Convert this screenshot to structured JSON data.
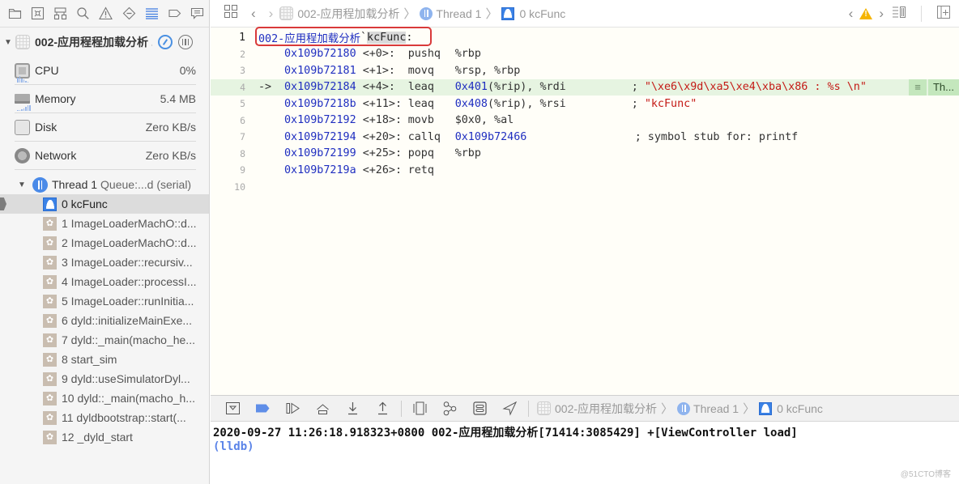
{
  "sidebar": {
    "nav_icons": [
      "folder-icon",
      "source-control-icon",
      "hierarchy-icon",
      "search-icon",
      "warning-icon",
      "breakpoint-icon",
      "debug-navigator-icon",
      "tag-icon",
      "report-icon"
    ],
    "process": {
      "name": "002-应用程程加载分析 ...",
      "icon": "app-icon"
    },
    "gauges": [
      {
        "label": "CPU",
        "value": "0%",
        "icon": "cpu-icon"
      },
      {
        "label": "Memory",
        "value": "5.4 MB",
        "icon": "memory-icon"
      },
      {
        "label": "Disk",
        "value": "Zero KB/s",
        "icon": "disk-icon"
      },
      {
        "label": "Network",
        "value": "Zero KB/s",
        "icon": "network-icon"
      }
    ],
    "thread": {
      "name": "Thread 1",
      "queue": "Queue:...d (serial)"
    },
    "frames": [
      {
        "label": "0 kcFunc",
        "type": "user",
        "selected": true
      },
      {
        "label": "1 ImageLoaderMachO::d...",
        "type": "system"
      },
      {
        "label": "2 ImageLoaderMachO::d...",
        "type": "system"
      },
      {
        "label": "3 ImageLoader::recursiv...",
        "type": "system"
      },
      {
        "label": "4 ImageLoader::processI...",
        "type": "system"
      },
      {
        "label": "5 ImageLoader::runInitia...",
        "type": "system"
      },
      {
        "label": "6 dyld::initializeMainExe...",
        "type": "system"
      },
      {
        "label": "7 dyld::_main(macho_he...",
        "type": "system"
      },
      {
        "label": "8 start_sim",
        "type": "system"
      },
      {
        "label": "9 dyld::useSimulatorDyl...",
        "type": "system"
      },
      {
        "label": "10 dyld::_main(macho_h...",
        "type": "system"
      },
      {
        "label": "11 dyldbootstrap::start(...",
        "type": "system"
      },
      {
        "label": "12 _dyld_start",
        "type": "system"
      }
    ]
  },
  "jump_bar": {
    "crumbs": [
      "002-应用程加载分析",
      "Thread 1",
      "0 kcFunc"
    ]
  },
  "editor": {
    "header": {
      "module": "002-应用程加载分析",
      "sep": "`",
      "symbol": "kcFunc",
      "colon": ":"
    },
    "lines": [
      {
        "n": "2",
        "addr": "0x109b72180",
        "off": "<+0>:",
        "op": "pushq",
        "args": "%rbp",
        "comment": ""
      },
      {
        "n": "3",
        "addr": "0x109b72181",
        "off": "<+1>:",
        "op": "movq",
        "args": "%rsp, %rbp",
        "comment": ""
      },
      {
        "n": "4",
        "addr": "0x109b72184",
        "off": "<+4>:",
        "op": "leaq",
        "argnum": "0x401",
        "args": "(%rip), %rdi",
        "comment": "; ",
        "str": "\"\\xe6\\x9d\\xa5\\xe4\\xba\\x86 : %s \\n\"",
        "current": true
      },
      {
        "n": "5",
        "addr": "0x109b7218b",
        "off": "<+11>:",
        "op": "leaq",
        "argnum": "0x408",
        "args": "(%rip), %rsi",
        "comment": "; ",
        "str": "\"kcFunc\""
      },
      {
        "n": "6",
        "addr": "0x109b72192",
        "off": "<+18>:",
        "op": "movb",
        "args": "$0x0, %al",
        "comment": ""
      },
      {
        "n": "7",
        "addr": "0x109b72194",
        "off": "<+20>:",
        "op": "callq",
        "argnum": "0x109b72466",
        "args": "",
        "comment": "; symbol stub for: printf"
      },
      {
        "n": "8",
        "addr": "0x109b72199",
        "off": "<+25>:",
        "op": "popq",
        "args": "%rbp",
        "comment": ""
      },
      {
        "n": "9",
        "addr": "0x109b7219a",
        "off": "<+26>:",
        "op": "retq",
        "args": "",
        "comment": ""
      },
      {
        "n": "10"
      }
    ],
    "current_arrow": "->",
    "annotation": {
      "icon": "≡",
      "label": "Th..."
    }
  },
  "debug_bar": {
    "buttons": [
      "hide-debug-area-icon",
      "breakpoints-toggle-icon",
      "continue-icon",
      "step-over-icon",
      "step-into-icon",
      "step-out-icon",
      "view-hierarchy-icon",
      "memory-graph-icon",
      "environment-overrides-icon",
      "simulate-location-icon"
    ],
    "crumbs": [
      "002-应用程加载分析",
      "Thread 1",
      "0 kcFunc"
    ]
  },
  "console": {
    "lines": [
      "2020-09-27 11:26:18.918323+0800 002-应用程加载分析[71414:3085429] +[ViewController load]"
    ],
    "prompt": "(lldb)"
  },
  "watermark": "@51CTO博客"
}
